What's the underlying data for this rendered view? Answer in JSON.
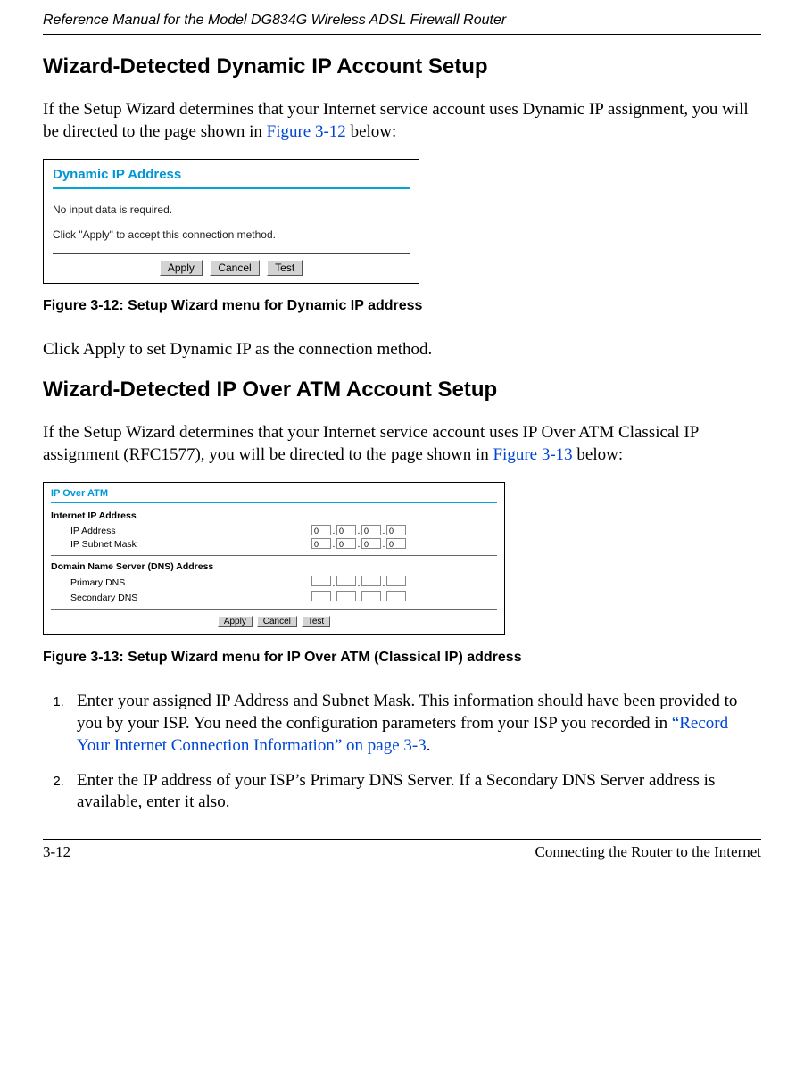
{
  "header": {
    "running_title": "Reference Manual for the Model DG834G Wireless ADSL Firewall Router"
  },
  "section1": {
    "heading": "Wizard-Detected Dynamic IP Account Setup",
    "intro_pre": "If the Setup Wizard determines that your Internet service account uses Dynamic IP assignment, you will be directed to the page shown in ",
    "intro_link": "Figure 3-12",
    "intro_post": " below:"
  },
  "fig1": {
    "panel_title": "Dynamic IP Address",
    "line1": "No input data is required.",
    "line2": "Click \"Apply\" to accept this connection method.",
    "buttons": {
      "apply": "Apply",
      "cancel": "Cancel",
      "test": "Test"
    },
    "caption": "Figure 3-12:  Setup Wizard menu for Dynamic IP address"
  },
  "section1_after": "Click Apply to set Dynamic IP as the connection method.",
  "section2": {
    "heading": "Wizard-Detected IP Over ATM Account Setup",
    "intro_pre": "If the Setup Wizard determines that your Internet service account uses IP Over ATM Classical IP assignment (RFC1577), you will be directed to the page shown in ",
    "intro_link": "Figure 3-13",
    "intro_post": " below:"
  },
  "fig2": {
    "panel_title": "IP Over ATM",
    "group1_title": "Internet IP Address",
    "row_ip": "IP Address",
    "row_mask": "IP Subnet Mask",
    "group2_title": "Domain Name Server (DNS) Address",
    "row_pdns": "Primary DNS",
    "row_sdns": "Secondary DNS",
    "zero": "0",
    "buttons": {
      "apply": "Apply",
      "cancel": "Cancel",
      "test": "Test"
    },
    "caption": "Figure 3-13:  Setup Wizard menu for IP Over ATM (Classical IP) address"
  },
  "steps": {
    "s1_pre": "Enter your assigned IP Address and Subnet Mask. This information should have been provided to you by your ISP. You need the configuration parameters from your ISP you recorded in ",
    "s1_link": "“Record Your Internet Connection Information” on page 3-3",
    "s1_post": ".",
    "s2": "Enter the IP address of your ISP’s Primary DNS Server. If a Secondary DNS Server address is available, enter it also."
  },
  "footer": {
    "page": "3-12",
    "chapter": "Connecting the Router to the Internet"
  }
}
